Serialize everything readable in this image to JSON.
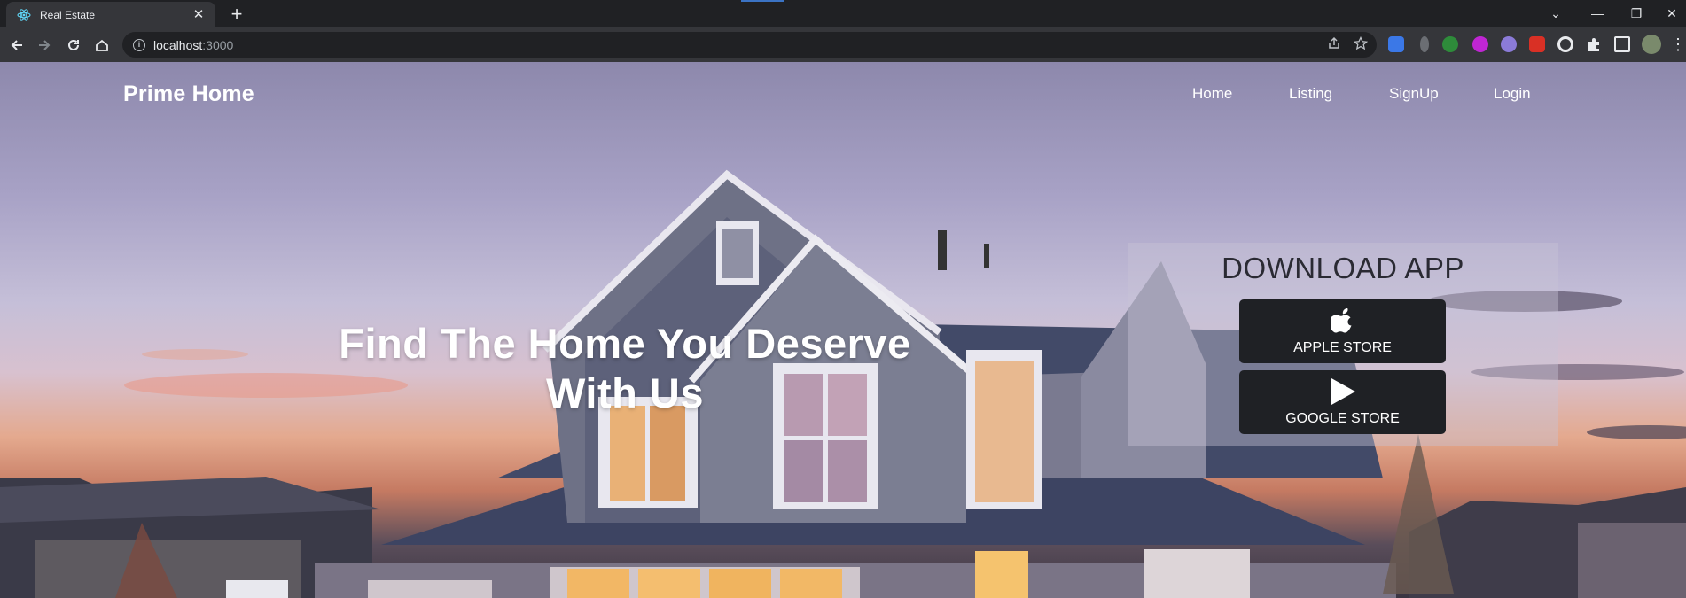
{
  "browser": {
    "tab": {
      "title": "Real Estate",
      "favicon": "react-icon",
      "close": "✕"
    },
    "new_tab": "+",
    "window": {
      "tab_search": "⌄",
      "minimize": "—",
      "restore": "❐",
      "close": "✕"
    },
    "address": {
      "host": "localhost",
      "port": ":3000"
    },
    "extensions": [
      "translate-icon",
      "extension-gray-icon",
      "tree-icon",
      "music-icon",
      "gem-icon",
      "red-extension-icon",
      "circle-extension-icon",
      "puzzle-icon",
      "sidebar-icon",
      "profile-avatar"
    ],
    "menu": "⋮"
  },
  "site": {
    "brand": "Prime Home",
    "nav": [
      "Home",
      "Listing",
      "SignUp",
      "Login"
    ],
    "hero_line1": "Find The Home You Deserve",
    "hero_line2": "With Us",
    "download": {
      "title": "DOWNLOAD APP",
      "apple": "APPLE STORE",
      "google": "GOOGLE STORE"
    }
  }
}
